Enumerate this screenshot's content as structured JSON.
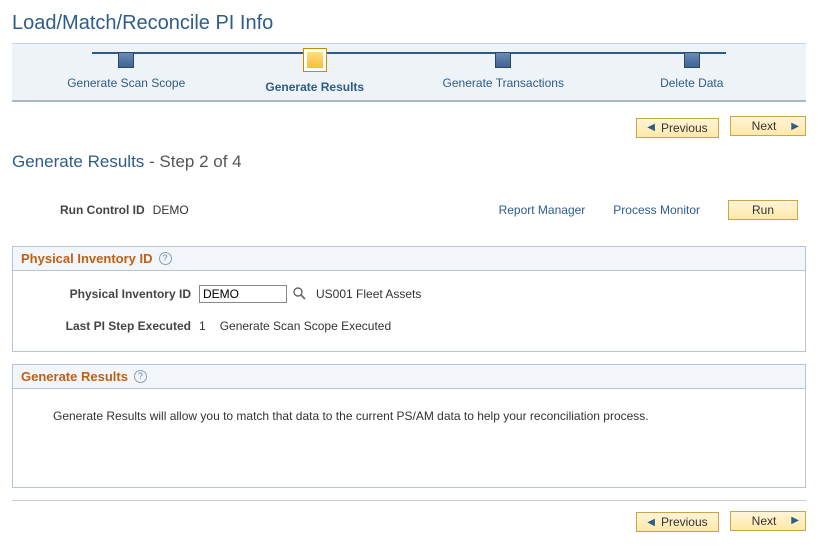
{
  "page": {
    "title": "Load/Match/Reconcile PI Info"
  },
  "train": {
    "stops": [
      {
        "label": "Generate Scan Scope",
        "current": false
      },
      {
        "label": "Generate Results",
        "current": true
      },
      {
        "label": "Generate Transactions",
        "current": false
      },
      {
        "label": "Delete Data",
        "current": false
      }
    ]
  },
  "nav": {
    "previous": "Previous",
    "next": "Next"
  },
  "step": {
    "title": "Generate Results",
    "suffix": " - Step 2 of 4"
  },
  "run_control": {
    "label": "Run Control ID",
    "value": "DEMO",
    "report_manager": "Report Manager",
    "process_monitor": "Process Monitor",
    "run_button": "Run"
  },
  "panel_inventory": {
    "title": "Physical Inventory ID",
    "field_label": "Physical Inventory ID",
    "field_value": "DEMO",
    "description": "US001 Fleet Assets",
    "last_step_label": "Last PI Step Executed",
    "last_step_num": "1",
    "last_step_text": "Generate Scan Scope Executed"
  },
  "panel_results": {
    "title": "Generate Results",
    "body": "Generate Results will allow you to match that data to the current PS/AM data to help your reconciliation process."
  }
}
